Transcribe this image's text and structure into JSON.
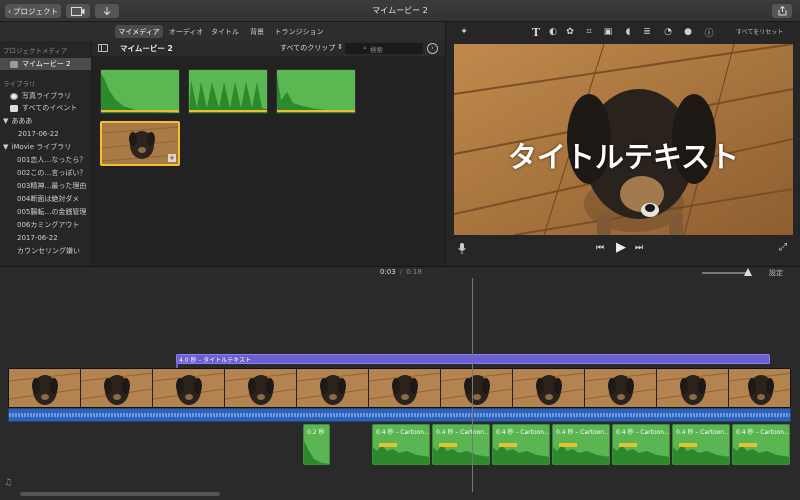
{
  "titlebar": {
    "projects_label": "プロジェクト",
    "window_title": "マイムービー 2"
  },
  "tabs": [
    "マイメディア",
    "オーディオ",
    "タイトル",
    "背景",
    "トランジション"
  ],
  "sidebar": {
    "project_media_header": "プロジェクトメディア",
    "project_item": "マイムービー 2",
    "library_header": "ライブラリ",
    "photos_library": "写真ライブラリ",
    "all_events": "すべてのイベント",
    "library_ahh": "あああ",
    "event_date": "2017-06-22",
    "imovie_library": "iMovie ライブラリ",
    "items": [
      "001恋人…なったら？",
      "002この…言っぽい？",
      "003精神…最った理由",
      "004断面は絶対ダメ",
      "005腸転…の金銭管理",
      "006カミングアウト",
      "2017-06-22",
      "カウンセリング嫌い"
    ]
  },
  "browser": {
    "title": "マイムービー 2",
    "filter_label": "すべてのクリップ",
    "search_placeholder": "検索"
  },
  "viewer": {
    "reset_all": "すべてをリセット",
    "title_text": "タイトルテキスト"
  },
  "timeline": {
    "current_time": "0:03",
    "separator": "/",
    "total_time": "0:18",
    "settings_label": "設定",
    "title_clip_label": "4.0 秒 – タイトルテキスト",
    "audio_clips": [
      "0.2 秒",
      "0.4 秒 – Cartoon…",
      "0.4 秒 – Cartoon…",
      "0.4 秒 – Cartoon…",
      "0.4 秒 – Cartoon…",
      "0.4 秒 – Cartoon…",
      "0.4 秒 – Cartoon…",
      "0.4 秒 – Cartoon…"
    ]
  },
  "colors": {
    "audio_green": "#5ab552",
    "title_purple": "#6b5fd6",
    "selection_yellow": "#f3c12f",
    "audio_blue": "#2f63b8"
  }
}
